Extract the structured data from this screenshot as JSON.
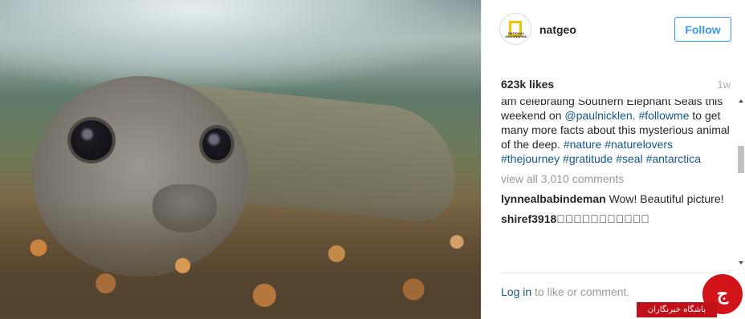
{
  "post": {
    "username": "natgeo",
    "avatar_text": "NATIONAL GEOGRAPHIC",
    "follow_label": "Follow",
    "likes": "623k likes",
    "time": "1w",
    "caption": {
      "text1": "am celebrating Southern Elephant Seals this weekend on ",
      "mention1": "@paulnicklen",
      "text2": ". ",
      "hashtag_followme": "#followme",
      "text3": " to get many more facts about this mysterious animal of the deep. ",
      "hashtags": "#nature #naturelovers #thejourney #gratitude #seal #antarctica"
    },
    "view_all": "view all 3,010 comments",
    "comments": [
      {
        "user": "lynnealbabindeman",
        "text": "Wow! Beautiful picture!"
      },
      {
        "user": "shiref3918",
        "text": "ً‍ٌٍّٰٖٗٗٗٗٗ"
      }
    ],
    "login_link": "Log in",
    "login_suffix": " to like or comment."
  },
  "watermark": {
    "text": "باشگاه خبرنگاران",
    "brand_color": "#c0111a"
  },
  "colors": {
    "link_blue": "#125688",
    "follow_blue": "#3897f0",
    "muted": "#999999"
  }
}
